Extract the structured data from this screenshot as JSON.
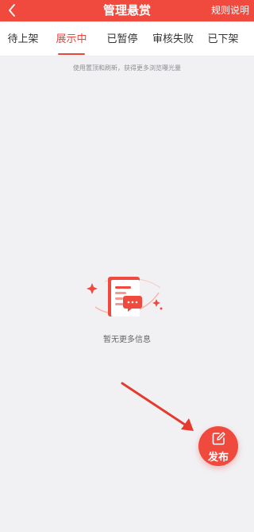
{
  "header": {
    "title": "管理悬赏",
    "back_icon": "chevron-left-icon",
    "rules_label": "规则说明"
  },
  "tabs": [
    {
      "label": "待上架",
      "active": false
    },
    {
      "label": "展示中",
      "active": true
    },
    {
      "label": "已暂停",
      "active": false
    },
    {
      "label": "审核失败",
      "active": false
    },
    {
      "label": "已下架",
      "active": false
    }
  ],
  "hint_text": "使用置顶和刷新，获得更多浏览曝光量",
  "empty_state": {
    "icon": "empty-document-chat-icon",
    "text": "暂无更多信息"
  },
  "fab": {
    "icon": "edit-icon",
    "label": "发布"
  },
  "colors": {
    "accent": "#ef4a3d",
    "background": "#f1f1f4"
  }
}
